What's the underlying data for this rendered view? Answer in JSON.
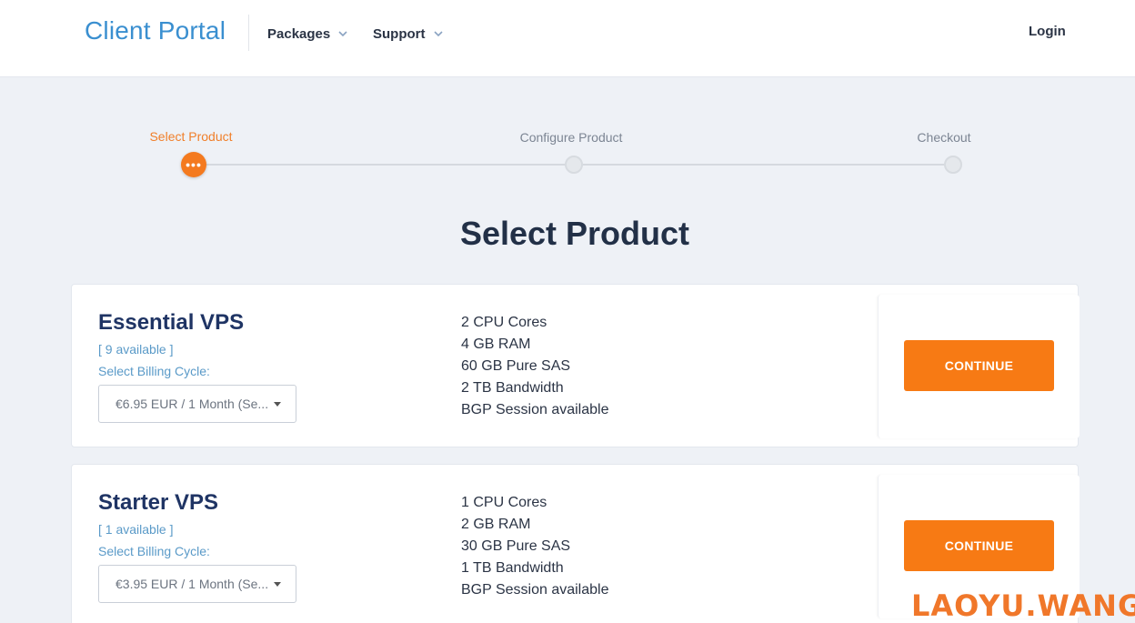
{
  "header": {
    "brand": "Client Portal",
    "nav": [
      {
        "label": "Packages"
      },
      {
        "label": "Support"
      }
    ],
    "login_label": "Login"
  },
  "stepper": {
    "steps": [
      {
        "label": "Select Product",
        "state": "active"
      },
      {
        "label": "Configure Product",
        "state": "pending"
      },
      {
        "label": "Checkout",
        "state": "pending"
      }
    ],
    "active_icon": "•••"
  },
  "page_title": "Select Product",
  "products": [
    {
      "name": "Essential VPS",
      "availability": "[ 9 available ]",
      "billing_label": "Select Billing Cycle:",
      "billing_selected": "€6.95 EUR / 1 Month (Se...",
      "features": [
        "2 CPU Cores",
        "4 GB RAM",
        "60 GB Pure SAS",
        "2 TB Bandwidth",
        "BGP Session available"
      ],
      "button_label": "CONTINUE"
    },
    {
      "name": "Starter VPS",
      "availability": "[ 1 available ]",
      "billing_label": "Select Billing Cycle:",
      "billing_selected": "€3.95 EUR / 1 Month (Se...",
      "features": [
        "1 CPU Cores",
        "2 GB RAM",
        "30 GB Pure SAS",
        "1 TB Bandwidth",
        "BGP Session available"
      ],
      "button_label": "CONTINUE"
    }
  ],
  "watermark": "LAOYU.WANG",
  "colors": {
    "brand": "#3a8fd0",
    "accent": "#f77a14",
    "heading": "#1f3464"
  }
}
